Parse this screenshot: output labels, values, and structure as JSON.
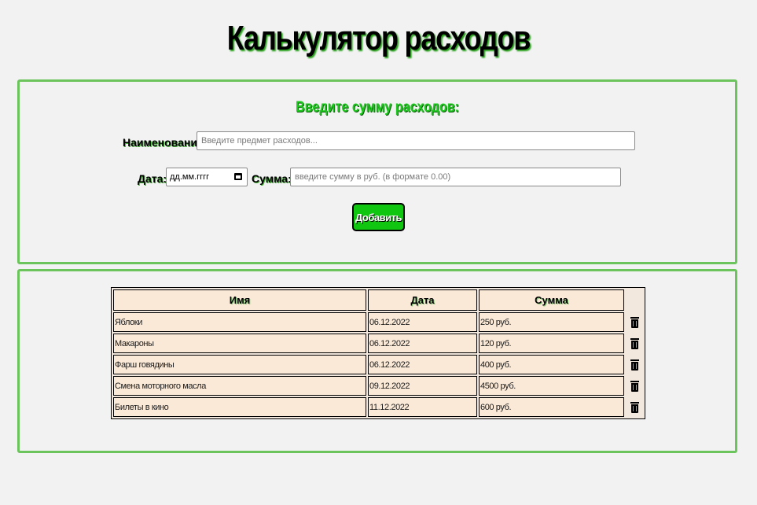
{
  "page": {
    "title": "Калькулятор расходов"
  },
  "form": {
    "heading": "Введите сумму расходов:",
    "name_label": "Наименование:",
    "name_placeholder": "Введите предмет расходов...",
    "date_label": "Дата:",
    "date_placeholder": "дд.мм.гггг",
    "sum_label": "Сумма:",
    "sum_placeholder": "введите сумму в руб. (в формате 0.00)",
    "add_button": "Добавить"
  },
  "table": {
    "headers": [
      "Имя",
      "Дата",
      "Сумма"
    ],
    "rows": [
      {
        "name": "Яблоки",
        "date": "06.12.2022",
        "sum": "250 руб."
      },
      {
        "name": "Макароны",
        "date": "06.12.2022",
        "sum": "120 руб."
      },
      {
        "name": "Фарш говядины",
        "date": "06.12.2022",
        "sum": "400 руб."
      },
      {
        "name": "Смена моторного масла",
        "date": "09.12.2022",
        "sum": "4500 руб."
      },
      {
        "name": "Билеты в кино",
        "date": "11.12.2022",
        "sum": "600 руб."
      }
    ]
  },
  "icons": {
    "delete": "trash-icon",
    "date_picker": "calendar-icon"
  },
  "colors": {
    "accent": "#1ec81e",
    "panel_border": "#6cc45c",
    "button": "#11c611",
    "cell_background": "#fbe9d7"
  }
}
